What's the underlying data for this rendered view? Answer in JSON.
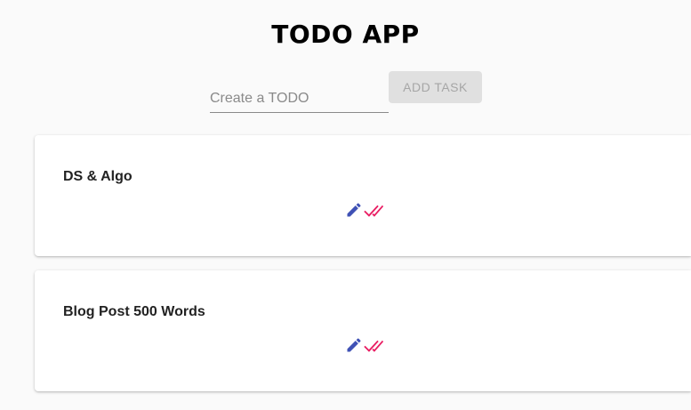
{
  "header": {
    "title": "TODO APP"
  },
  "form": {
    "placeholder": "Create a TODO",
    "value": "",
    "add_label": "ADD TASK"
  },
  "todos": [
    {
      "title": "DS & Algo",
      "edit_icon": "pencil-icon",
      "done_icon": "double-check-icon"
    },
    {
      "title": "Blog Post 500 Words",
      "edit_icon": "pencil-icon",
      "done_icon": "double-check-icon"
    }
  ],
  "colors": {
    "edit_icon": "#3f51b5",
    "done_icon": "#e91e63",
    "button_disabled_bg": "#e0e0e0",
    "button_disabled_text": "#a6a6a6"
  }
}
